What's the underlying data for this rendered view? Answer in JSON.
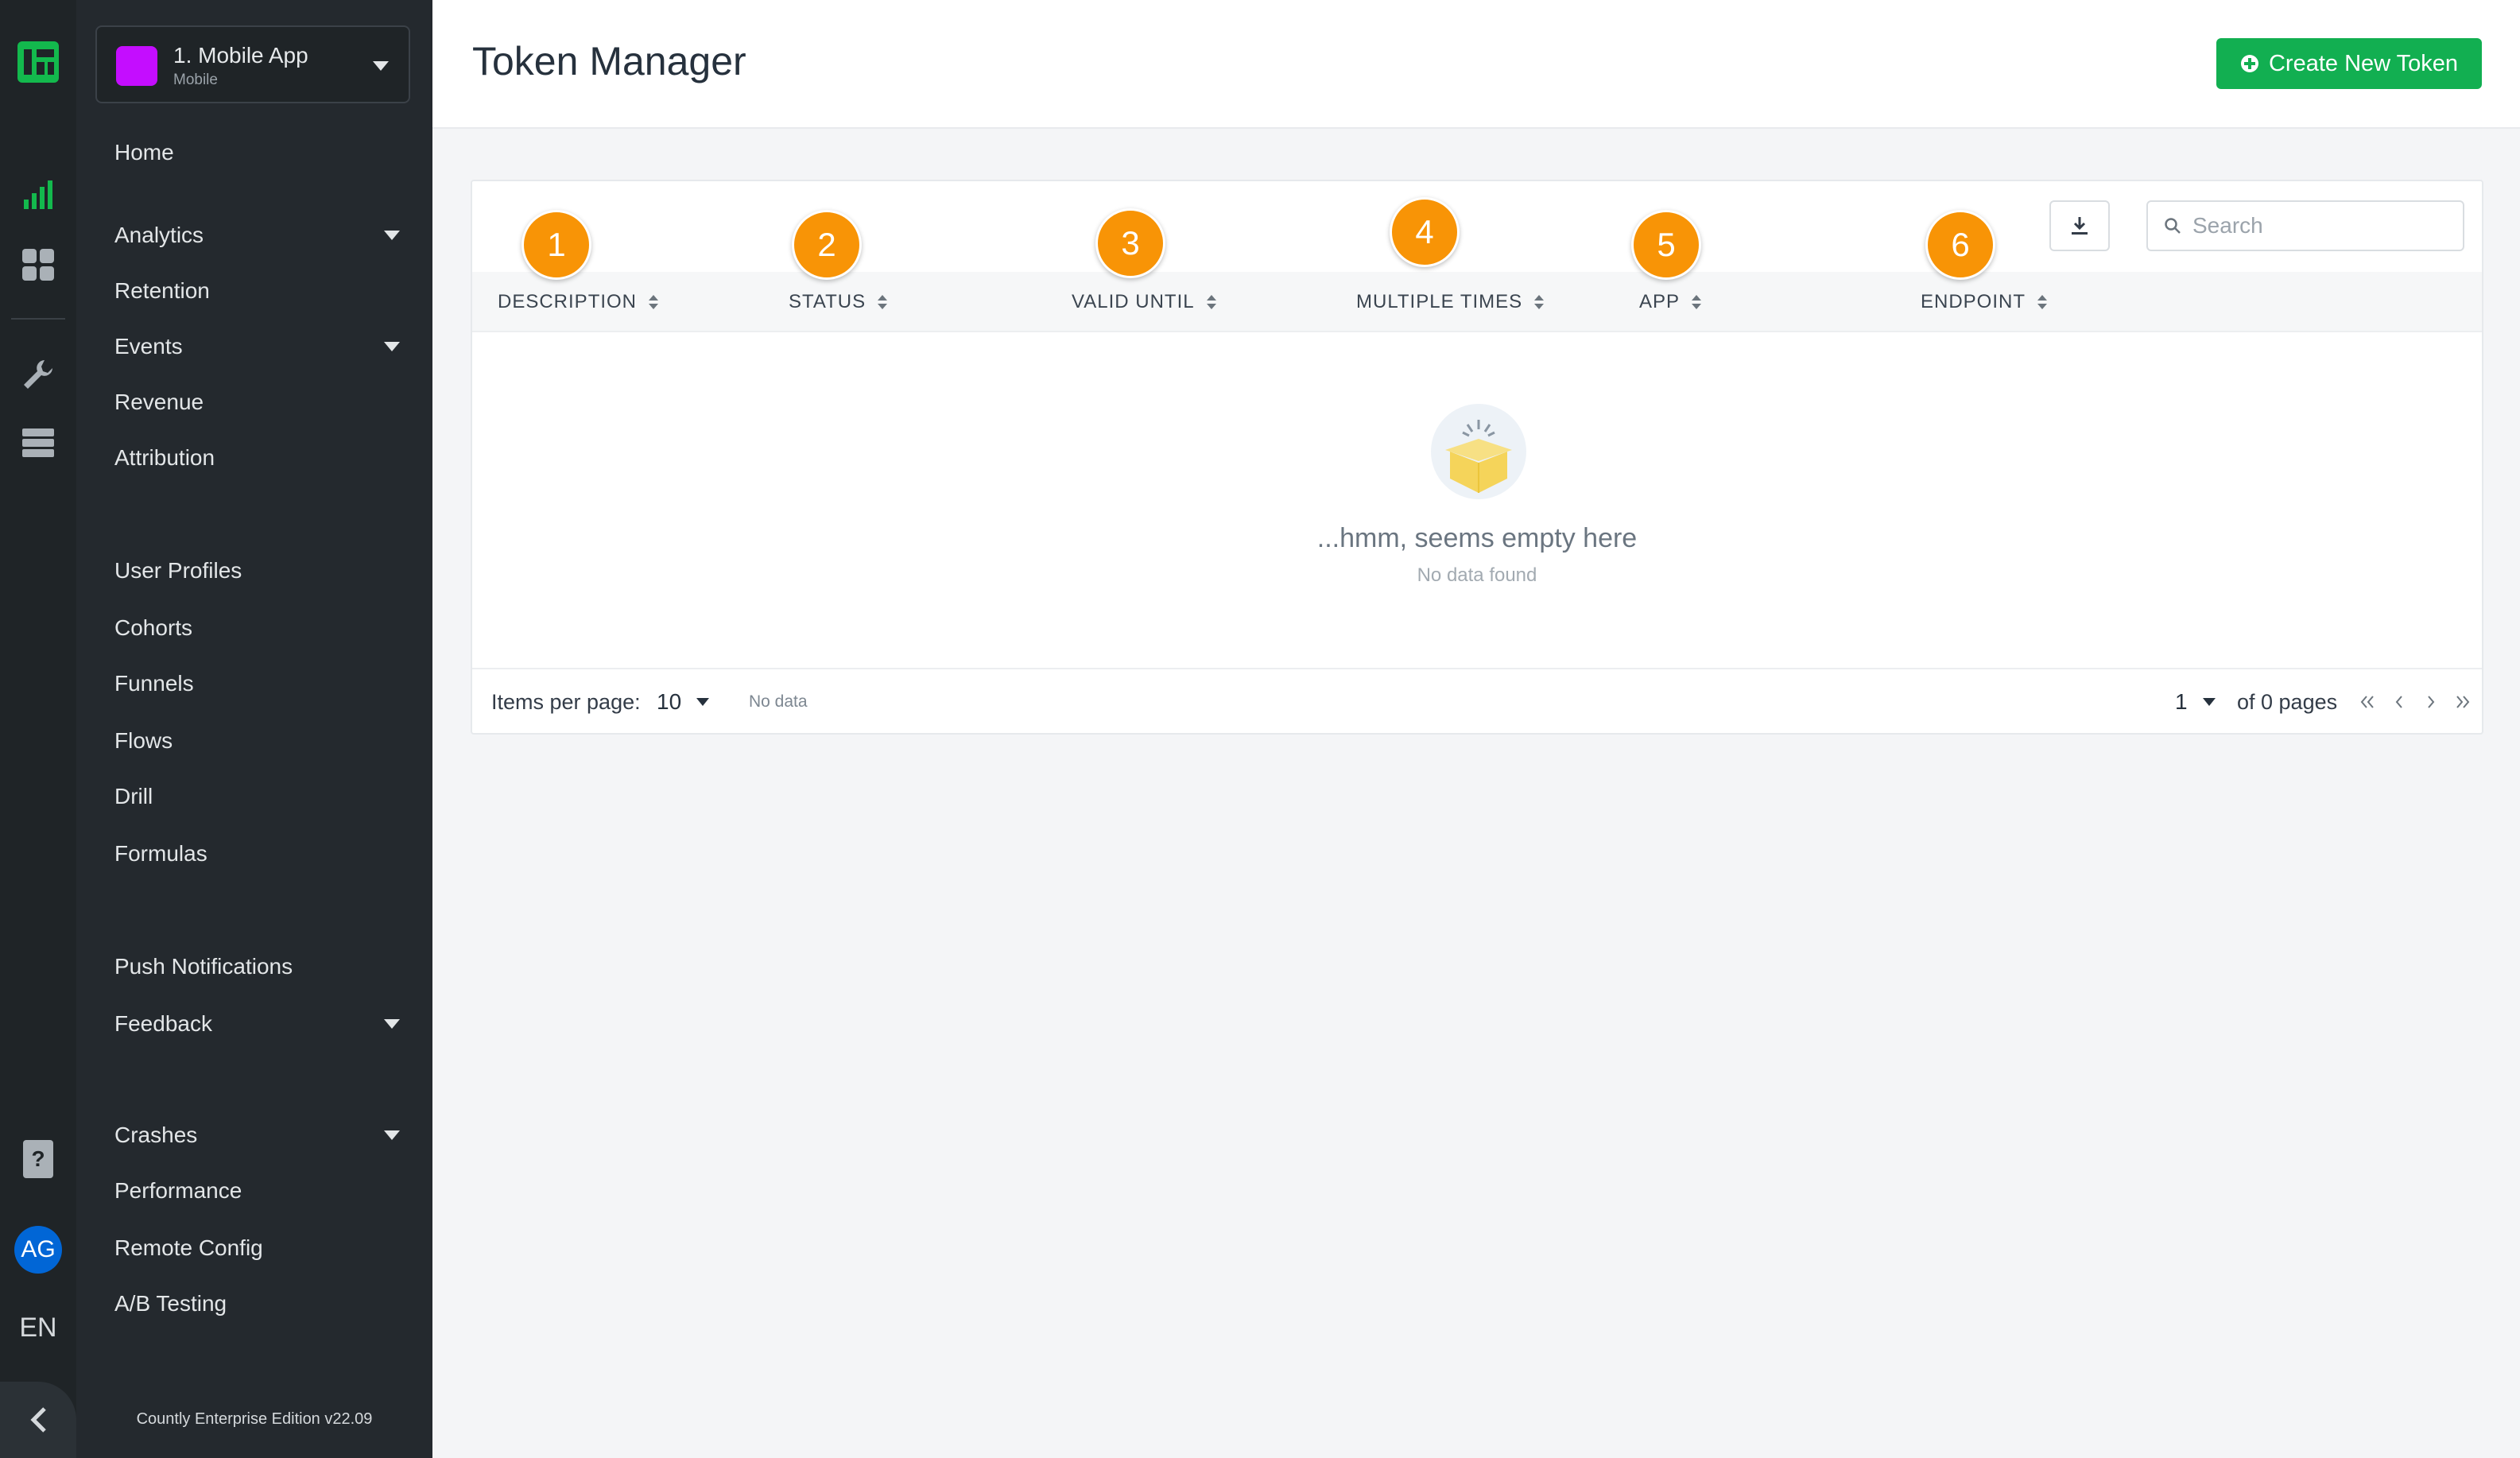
{
  "app_select": {
    "name": "1. Mobile App",
    "type": "Mobile",
    "color": "#c40dff"
  },
  "nav": {
    "items": [
      {
        "label": "Home",
        "dropdown": false
      },
      {
        "label": "Analytics",
        "dropdown": true
      },
      {
        "label": "Retention",
        "dropdown": false
      },
      {
        "label": "Events",
        "dropdown": true
      },
      {
        "label": "Revenue",
        "dropdown": false
      },
      {
        "label": "Attribution",
        "dropdown": false
      },
      {
        "label": "User Profiles",
        "dropdown": false
      },
      {
        "label": "Cohorts",
        "dropdown": false
      },
      {
        "label": "Funnels",
        "dropdown": false
      },
      {
        "label": "Flows",
        "dropdown": false
      },
      {
        "label": "Drill",
        "dropdown": false
      },
      {
        "label": "Formulas",
        "dropdown": false
      },
      {
        "label": "Push Notifications",
        "dropdown": false
      },
      {
        "label": "Feedback",
        "dropdown": true
      },
      {
        "label": "Crashes",
        "dropdown": true
      },
      {
        "label": "Performance",
        "dropdown": false
      },
      {
        "label": "Remote Config",
        "dropdown": false
      },
      {
        "label": "A/B Testing",
        "dropdown": false
      }
    ],
    "version": "Countly Enterprise Edition v22.09"
  },
  "rail": {
    "avatar_initials": "AG",
    "language": "EN"
  },
  "header": {
    "title": "Token Manager",
    "create_button": "Create New Token"
  },
  "table": {
    "search_placeholder": "Search",
    "columns": [
      {
        "label": "DESCRIPTION",
        "badge": "1"
      },
      {
        "label": "STATUS",
        "badge": "2"
      },
      {
        "label": "VALID UNTIL",
        "badge": "3"
      },
      {
        "label": "MULTIPLE TIMES",
        "badge": "4"
      },
      {
        "label": "APP",
        "badge": "5"
      },
      {
        "label": "ENDPOINT",
        "badge": "6"
      }
    ],
    "empty_title": "...hmm, seems empty here",
    "empty_subtitle": "No data found"
  },
  "pagination": {
    "items_per_page_label": "Items per page:",
    "items_per_page": "10",
    "no_data": "No data",
    "page": "1",
    "of_pages": "of 0 pages"
  },
  "colors": {
    "accent_green": "#12af51",
    "badge_orange": "#f89406",
    "sidebar": "#24292e"
  }
}
